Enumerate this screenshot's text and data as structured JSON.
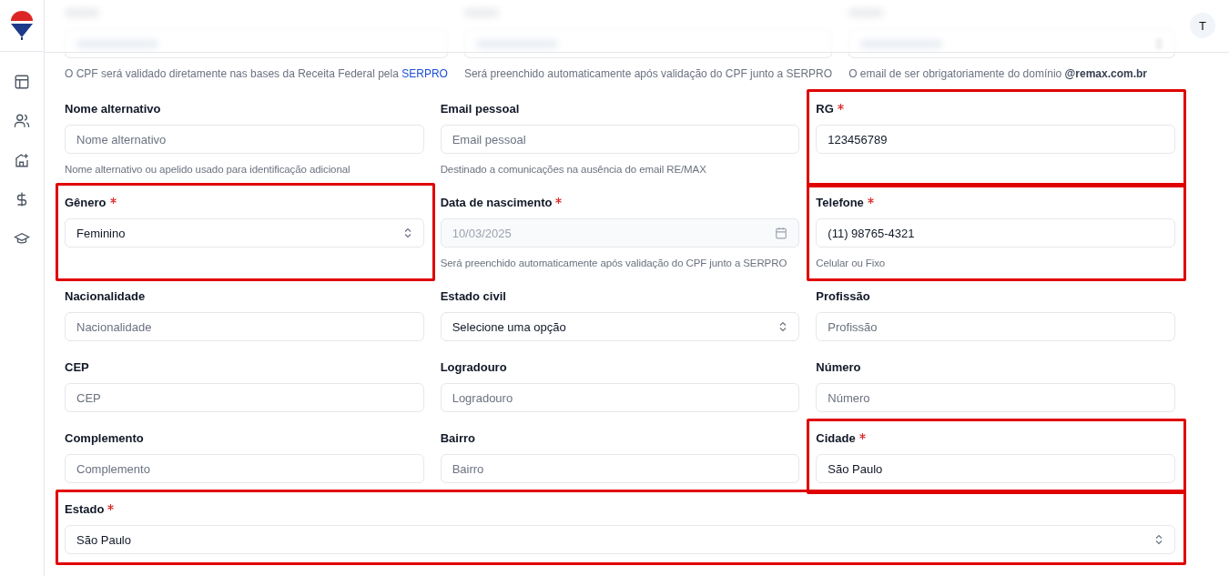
{
  "header": {
    "avatar": "T"
  },
  "sidebar": {
    "items": [
      {
        "kind": "layout"
      },
      {
        "kind": "users"
      },
      {
        "kind": "house"
      },
      {
        "kind": "dollar"
      },
      {
        "kind": "graduation"
      }
    ]
  },
  "top_row": [
    {
      "kind": "text",
      "help": "O CPF será validado diretamente nas bases da Receita Federal pela ",
      "help_link": "SERPRO"
    },
    {
      "kind": "text",
      "help": "Será preenchido automaticamente após validação do CPF junto a SERPRO"
    },
    {
      "kind": "select",
      "help": "O email de ser obrigatoriamente do domínio **@remax.com.br**"
    }
  ],
  "rows": [
    [
      {
        "label": "Nome alternativo",
        "required": false,
        "kind": "text",
        "placeholder": "Nome alternativo",
        "help": "Nome alternativo ou apelido usado para identificação adicional",
        "highlighted": false
      },
      {
        "label": "Email pessoal",
        "required": false,
        "kind": "text",
        "placeholder": "Email pessoal",
        "help": "Destinado a comunicações na ausência do email RE/MAX",
        "highlighted": false
      },
      {
        "label": "RG",
        "required": true,
        "kind": "text",
        "value": "123456789",
        "highlighted": true
      }
    ],
    [
      {
        "label": "Gênero",
        "required": true,
        "kind": "select",
        "value": "Feminino",
        "highlighted": true
      },
      {
        "label": "Data de nascimento",
        "required": true,
        "kind": "date",
        "value": "10/03/2025",
        "disabled": true,
        "help": "Será preenchido automaticamente após validação do CPF junto a SERPRO",
        "highlighted": false
      },
      {
        "label": "Telefone",
        "required": true,
        "kind": "text",
        "value": "(11) 98765-4321",
        "help": "Celular ou Fixo",
        "highlighted": true
      }
    ],
    [
      {
        "label": "Nacionalidade",
        "required": false,
        "kind": "text",
        "placeholder": "Nacionalidade",
        "highlighted": false
      },
      {
        "label": "Estado civil",
        "required": false,
        "kind": "select",
        "value": "Selecione uma opção",
        "highlighted": false
      },
      {
        "label": "Profissão",
        "required": false,
        "kind": "text",
        "placeholder": "Profissão",
        "highlighted": false
      }
    ],
    [
      {
        "label": "CEP",
        "required": false,
        "kind": "text",
        "placeholder": "CEP",
        "highlighted": false
      },
      {
        "label": "Logradouro",
        "required": false,
        "kind": "text",
        "placeholder": "Logradouro",
        "highlighted": false
      },
      {
        "label": "Número",
        "required": false,
        "kind": "text",
        "placeholder": "Número",
        "highlighted": false
      }
    ],
    [
      {
        "label": "Complemento",
        "required": false,
        "kind": "text",
        "placeholder": "Complemento",
        "highlighted": false
      },
      {
        "label": "Bairro",
        "required": false,
        "kind": "text",
        "placeholder": "Bairro",
        "highlighted": false
      },
      {
        "label": "Cidade",
        "required": true,
        "kind": "text",
        "value": "São Paulo",
        "highlighted": true
      }
    ],
    [
      {
        "label": "Estado",
        "required": true,
        "kind": "select",
        "value": "São Paulo",
        "highlighted": true
      }
    ]
  ]
}
